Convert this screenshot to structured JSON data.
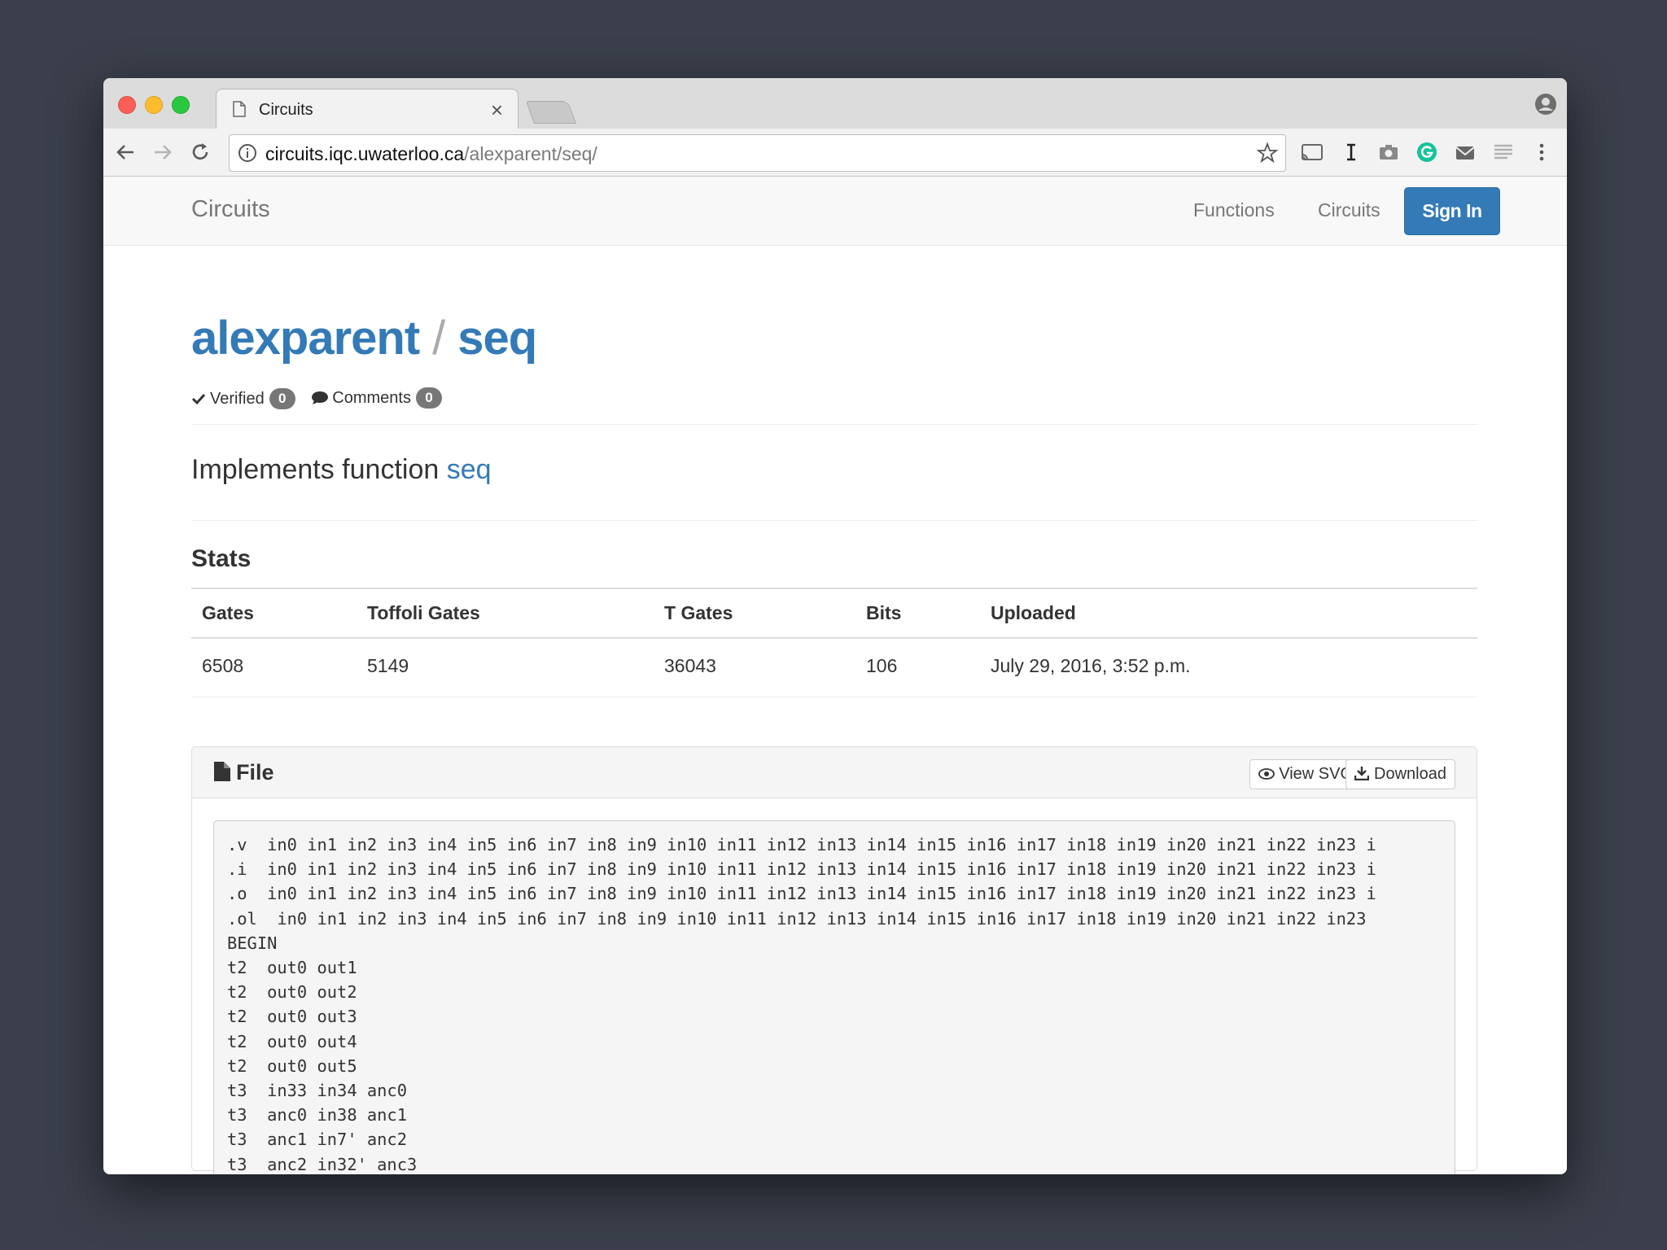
{
  "browser": {
    "tab_title": "Circuits",
    "url_host": "circuits.iqc.uwaterloo.ca",
    "url_path": "/alexparent/seq/"
  },
  "navbar": {
    "brand": "Circuits",
    "links": [
      "Functions",
      "Circuits"
    ],
    "sign_in": "Sign In"
  },
  "header": {
    "owner": "alexparent",
    "separator": "/",
    "name": "seq",
    "verified_label": "Verified",
    "verified_count": "0",
    "comments_label": "Comments",
    "comments_count": "0"
  },
  "implements": {
    "prefix": "Implements function",
    "function": "seq"
  },
  "stats": {
    "title": "Stats",
    "columns": [
      "Gates",
      "Toffoli Gates",
      "T Gates",
      "Bits",
      "Uploaded"
    ],
    "row": [
      "6508",
      "5149",
      "36043",
      "106",
      "July 29, 2016, 3:52 p.m."
    ]
  },
  "file": {
    "title": "File",
    "view_svg": "View SVG",
    "download": "Download",
    "lines": [
      ".v  in0 in1 in2 in3 in4 in5 in6 in7 in8 in9 in10 in11 in12 in13 in14 in15 in16 in17 in18 in19 in20 in21 in22 in23 i",
      ".i  in0 in1 in2 in3 in4 in5 in6 in7 in8 in9 in10 in11 in12 in13 in14 in15 in16 in17 in18 in19 in20 in21 in22 in23 i",
      ".o  in0 in1 in2 in3 in4 in5 in6 in7 in8 in9 in10 in11 in12 in13 in14 in15 in16 in17 in18 in19 in20 in21 in22 in23 i",
      ".ol  in0 in1 in2 in3 in4 in5 in6 in7 in8 in9 in10 in11 in12 in13 in14 in15 in16 in17 in18 in19 in20 in21 in22 in23",
      "BEGIN",
      "t2  out0 out1",
      "t2  out0 out2",
      "t2  out0 out3",
      "t2  out0 out4",
      "t2  out0 out5",
      "t3  in33 in34 anc0",
      "t3  anc0 in38 anc1",
      "t3  anc1 in7' anc2",
      "t3  anc2 in32' anc3"
    ]
  },
  "colors": {
    "link": "#337ab7",
    "primary_button": "#337ab7",
    "badge": "#777777",
    "backdrop": "#3a3f4b"
  }
}
